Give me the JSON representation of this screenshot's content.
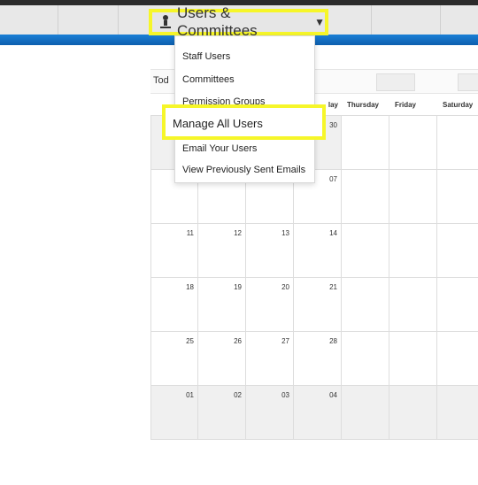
{
  "nav": {
    "menu_label": "Users & Committees",
    "menu_icon": "user-icon",
    "caret": "▼"
  },
  "dropdown": {
    "items": [
      "Staff Users",
      "Committees",
      "Permission Groups",
      "Manage All Users",
      "Email Your Users",
      "View Previously Sent Emails"
    ],
    "highlighted": "Manage All Users"
  },
  "toolbar": {
    "today_label": "Tod"
  },
  "calendar": {
    "headers": [
      "",
      "",
      "",
      "lay",
      "Thursday",
      "Friday",
      "Saturday"
    ],
    "rows": [
      [
        "",
        "",
        "",
        "30",
        "",
        "",
        ""
      ],
      [
        "",
        "",
        "",
        "07",
        "",
        "",
        ""
      ],
      [
        "11",
        "12",
        "13",
        "14",
        "",
        "",
        ""
      ],
      [
        "18",
        "19",
        "20",
        "21",
        "",
        "",
        ""
      ],
      [
        "25",
        "26",
        "27",
        "28",
        "",
        "",
        ""
      ],
      [
        "01",
        "02",
        "03",
        "04",
        "",
        "",
        ""
      ]
    ]
  },
  "colors": {
    "accent": "#1a7fd6",
    "highlight": "#f6f629"
  }
}
